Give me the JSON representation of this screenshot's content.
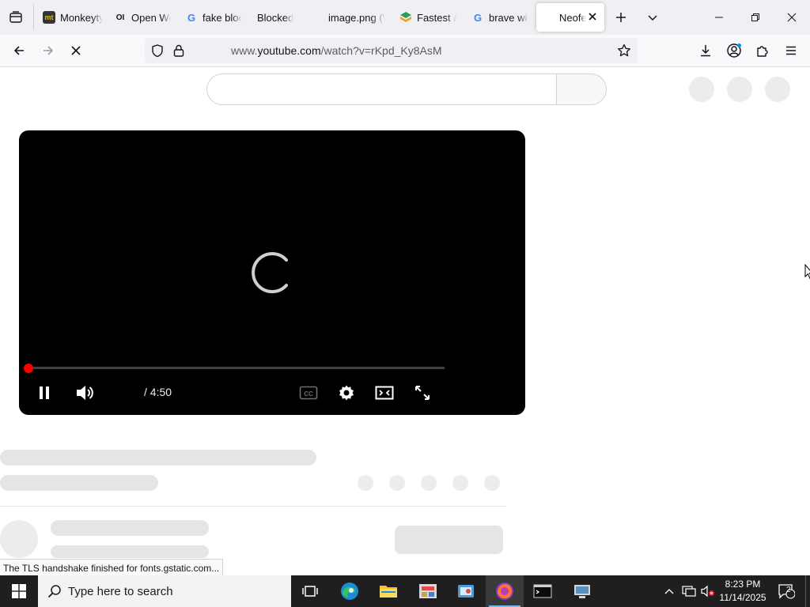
{
  "browser": {
    "tabs": [
      {
        "title": "Monkeytype",
        "favicon_text": "mt",
        "favicon_color": "#e2b714",
        "favicon_bg": "#323437"
      },
      {
        "title": "Open WebUI",
        "favicon_text": "OI",
        "favicon_color": "#111111",
        "favicon_bg": "transparent"
      },
      {
        "title": "fake blocked",
        "favicon_text": "G",
        "favicon_color": "#4285f4",
        "favicon_bg": "transparent"
      },
      {
        "title": "Blocked",
        "favicon_text": "",
        "favicon_color": "#000",
        "favicon_bg": "transparent"
      },
      {
        "title": "image.png (WEBP",
        "favicon_text": "",
        "favicon_color": "#000",
        "favicon_bg": "transparent"
      },
      {
        "title": "Fastest & Most",
        "favicon_text": "◆",
        "favicon_color": "#2a9d57",
        "favicon_bg": "transparent"
      },
      {
        "title": "brave window",
        "favicon_text": "G",
        "favicon_color": "#4285f4",
        "favicon_bg": "transparent"
      },
      {
        "title": "Neofetch",
        "favicon_text": "",
        "favicon_color": "#000",
        "favicon_bg": "transparent",
        "active": true
      }
    ],
    "url_prefix": "www.",
    "url_domain": "youtube.com",
    "url_path": "/watch?v=rKpd_Ky8AsM",
    "status_text": "The TLS handshake finished for fonts.gstatic.com..."
  },
  "player": {
    "time_current": "",
    "time_separator": "/",
    "time_total": "4:50",
    "progress": 0.0,
    "accent_color": "#ff0000"
  },
  "taskbar": {
    "search_placeholder": "Type here to search",
    "clock_time": "8:23 PM",
    "clock_date": "11/14/2025",
    "notification_count": "2"
  },
  "icons": [
    "tab-list-icon",
    "new-tab-icon",
    "tab-overflow-icon",
    "back-icon",
    "forward-icon",
    "stop-icon",
    "shield-icon",
    "lock-icon",
    "bookmark-star-icon",
    "downloads-icon",
    "account-icon",
    "extensions-icon",
    "menu-icon",
    "pause-icon",
    "volume-icon",
    "captions-icon",
    "settings-gear-icon",
    "theater-mode-icon",
    "fullscreen-icon",
    "windows-start-icon",
    "search-icon",
    "task-view-icon",
    "edge-icon",
    "file-explorer-icon",
    "firefox-icon",
    "terminal-icon"
  ]
}
